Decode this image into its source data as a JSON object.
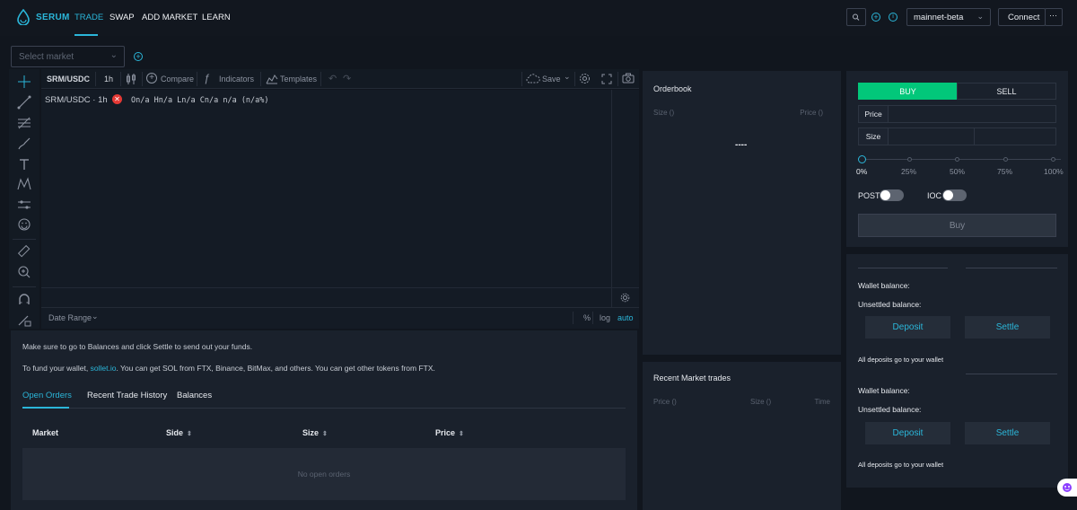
{
  "nav": {
    "brand": "SERUM",
    "links": [
      "TRADE",
      "SWAP",
      "ADD MARKET",
      "LEARN"
    ],
    "network": "mainnet-beta",
    "connect_label": "Connect",
    "more_label": "···"
  },
  "market_select": {
    "placeholder": "Select market"
  },
  "chart": {
    "symbol": "SRM/USDC",
    "interval": "1h",
    "toolbar": {
      "compare": "Compare",
      "indicators": "Indicators",
      "templates": "Templates",
      "save": "Save"
    },
    "legend_symbol": "SRM/USDC · 1h",
    "legend_values": "On/a Hn/a Ln/a Cn/a n/a (n/a%)",
    "date_range": "Date Range",
    "pct": "%",
    "log": "log",
    "auto": "auto"
  },
  "orderbook": {
    "title": "Orderbook",
    "size_col": "Size ()",
    "price_col": "Price ()",
    "empty": "----"
  },
  "trades": {
    "title": "Recent Market trades",
    "price_col": "Price ()",
    "size_col": "Size ()",
    "time_col": "Time"
  },
  "order_form": {
    "buy": "BUY",
    "sell": "SELL",
    "price_label": "Price",
    "size_label": "Size",
    "slider_labels": [
      "0%",
      "25%",
      "50%",
      "75%",
      "100%"
    ],
    "post_label": "POST",
    "ioc_label": "IOC",
    "submit": "Buy"
  },
  "balances": {
    "wallet_balance": "Wallet balance:",
    "unsettled_balance": "Unsettled balance:",
    "deposit": "Deposit",
    "settle": "Settle",
    "note": "All deposits go to your wallet"
  },
  "bottom": {
    "info1": "Make sure to go to Balances and click Settle to send out your funds.",
    "info2_prefix": "To fund your wallet, ",
    "info2_link": "sollet.io",
    "info2_suffix": ". You can get SOL from FTX, Binance, BitMax, and others. You can get other tokens from FTX.",
    "tabs": [
      "Open Orders",
      "Recent Trade History",
      "Balances"
    ],
    "columns": [
      "Market",
      "Side",
      "Size",
      "Price"
    ],
    "empty": "No open orders"
  },
  "colors": {
    "accent": "#2bb6d9",
    "buy": "#02c77a",
    "error": "#e53935"
  }
}
